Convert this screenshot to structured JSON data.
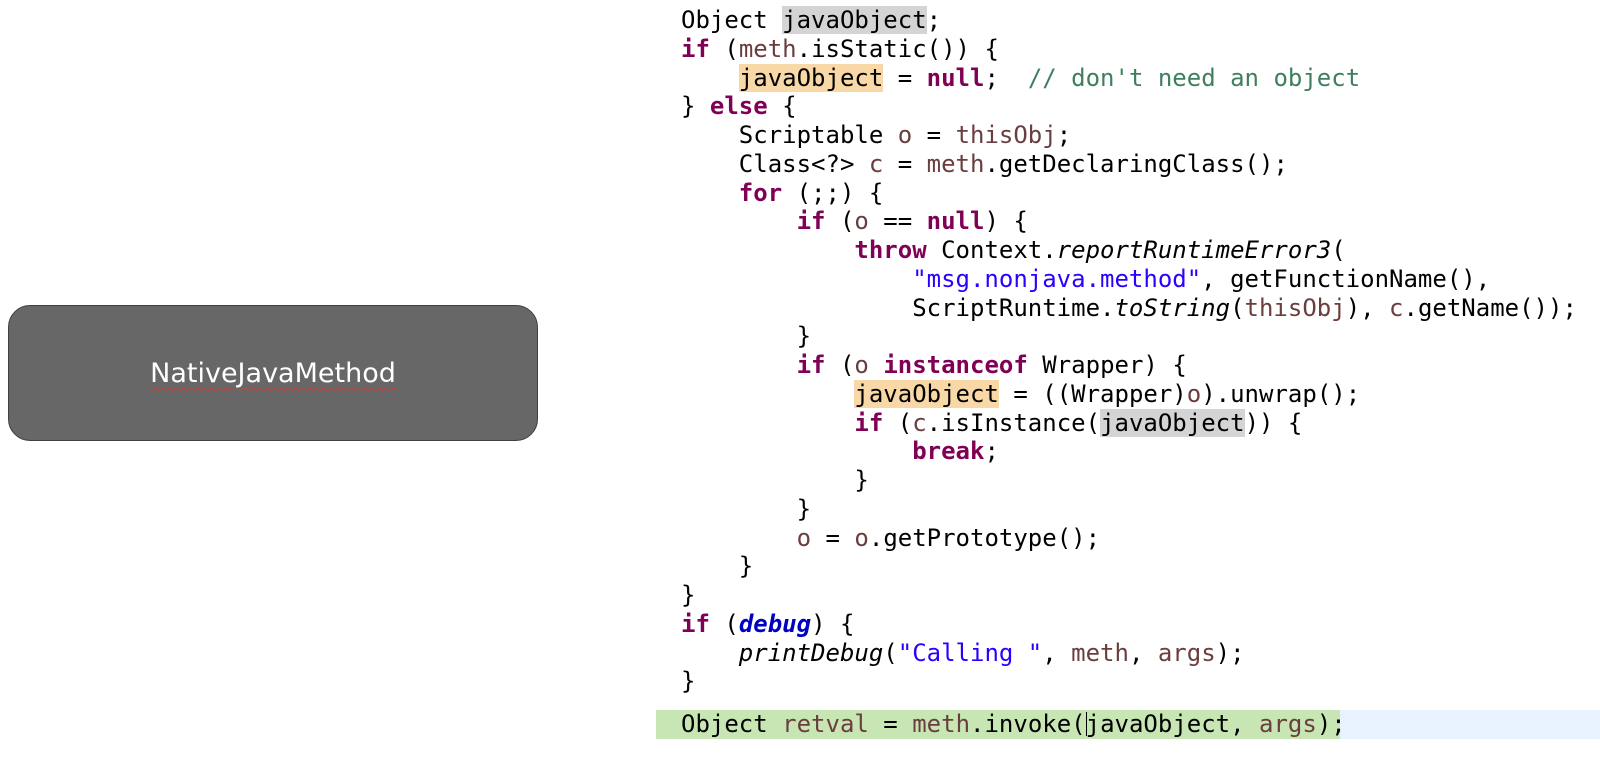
{
  "label": {
    "text": "NativeJavaMethod"
  },
  "code": {
    "kw_if": "if",
    "kw_else": "else",
    "kw_null": "null",
    "kw_for": "for",
    "kw_throw": "throw",
    "kw_instanceof": "instanceof",
    "kw_break": "break",
    "type_object": "Object",
    "type_scriptable": "Scriptable",
    "type_class": "Class<?>",
    "type_wrapper": "Wrapper",
    "var_javaObject": "javaObject",
    "var_meth": "meth",
    "var_o": "o",
    "var_c": "c",
    "var_thisObj": "thisObj",
    "var_args": "args",
    "var_retval": "retval",
    "field_debug": "debug",
    "comment_no_object": "// don't need an object",
    "str_msg": "\"msg.nonjava.method\"",
    "str_calling": "\"Calling \"",
    "m_isStatic": "isStatic",
    "m_getDeclaringClass": "getDeclaringClass",
    "m_context": "Context.",
    "m_reportRuntimeError3": "reportRuntimeError3",
    "m_getFunctionName": "getFunctionName",
    "m_scriptRuntime": "ScriptRuntime.",
    "m_toString": "toString",
    "m_getName": "getName",
    "m_unwrap": "unwrap",
    "m_isInstance": "isInstance",
    "m_getPrototype": "getPrototype",
    "m_printDebug": "printDebug",
    "m_invoke": "invoke"
  }
}
